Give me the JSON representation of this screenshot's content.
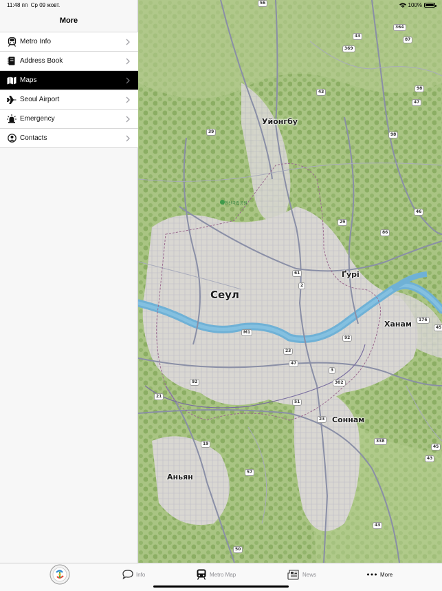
{
  "status_bar": {
    "time": "11:48 пп",
    "date": "Ср 09 жовт.",
    "battery": "100%"
  },
  "sidebar": {
    "title": "More",
    "items": [
      {
        "label": "Metro Info",
        "icon": "train-icon"
      },
      {
        "label": "Address Book",
        "icon": "address-book-icon"
      },
      {
        "label": "Maps",
        "icon": "map-icon",
        "selected": true
      },
      {
        "label": "Seoul Airport",
        "icon": "airplane-icon"
      },
      {
        "label": "Emergency",
        "icon": "siren-icon"
      },
      {
        "label": "Contacts",
        "icon": "person-circle-icon"
      }
    ]
  },
  "map": {
    "labels": {
      "seoul": "Сеул",
      "uijeongbu": "Уйонгбу",
      "guri": "Ґурі",
      "hanam": "Ханам",
      "seongnam": "Соннам",
      "anyang": "Аньян",
      "park": "북한산국립공원"
    },
    "shields": [
      "56",
      "364",
      "87",
      "43",
      "369",
      "98",
      "43",
      "47",
      "39",
      "98",
      "46",
      "29",
      "86",
      "61",
      "2",
      "176",
      "45",
      "M1",
      "92",
      "23",
      "47",
      "3",
      "302",
      "92",
      "21",
      "51",
      "23",
      "338",
      "45",
      "19",
      "43",
      "57",
      "43",
      "50"
    ]
  },
  "tabbar": {
    "tabs": [
      {
        "label": "",
        "icon": "app-logo-icon"
      },
      {
        "label": "Info",
        "icon": "chat-bubble-icon"
      },
      {
        "label": "Metro Map",
        "icon": "metro-train-icon"
      },
      {
        "label": "News",
        "icon": "newspaper-icon"
      },
      {
        "label": "More",
        "icon": "ellipsis-icon"
      }
    ]
  },
  "colors": {
    "selected_bg": "#000000",
    "map_land": "#c9d6a8",
    "river": "#6fb1d6",
    "forest": "#8fb56a"
  }
}
